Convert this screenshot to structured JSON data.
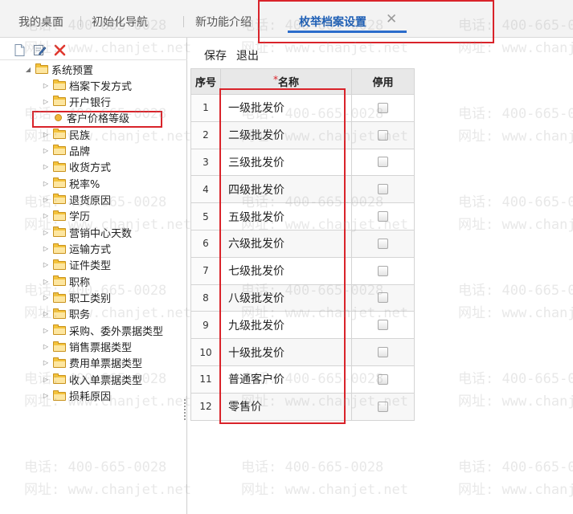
{
  "tabs": [
    {
      "label": "我的桌面"
    },
    {
      "label": "初始化导航"
    },
    {
      "label": "新功能介绍"
    },
    {
      "label": "枚举档案设置",
      "active": true
    }
  ],
  "tree": {
    "root": "系统预置",
    "items": [
      {
        "label": "档案下发方式"
      },
      {
        "label": "开户银行"
      },
      {
        "label": "客户价格等级",
        "selected": true
      },
      {
        "label": "民族"
      },
      {
        "label": "品牌"
      },
      {
        "label": "收货方式"
      },
      {
        "label": "税率%"
      },
      {
        "label": "退货原因"
      },
      {
        "label": "学历"
      },
      {
        "label": "营销中心天数"
      },
      {
        "label": "运输方式"
      },
      {
        "label": "证件类型"
      },
      {
        "label": "职称"
      },
      {
        "label": "职工类别"
      },
      {
        "label": "职务"
      },
      {
        "label": "采购、委外票据类型"
      },
      {
        "label": "销售票据类型"
      },
      {
        "label": "费用单票据类型"
      },
      {
        "label": "收入单票据类型"
      },
      {
        "label": "损耗原因"
      }
    ]
  },
  "toolbar": {
    "save_label": "保存",
    "exit_label": "退出"
  },
  "table": {
    "headers": {
      "no": "序号",
      "required_mark": "*",
      "name": "名称",
      "disabled": "停用"
    },
    "rows": [
      {
        "no": "1",
        "name": "一级批发价"
      },
      {
        "no": "2",
        "name": "二级批发价"
      },
      {
        "no": "3",
        "name": "三级批发价"
      },
      {
        "no": "4",
        "name": "四级批发价"
      },
      {
        "no": "5",
        "name": "五级批发价"
      },
      {
        "no": "6",
        "name": "六级批发价"
      },
      {
        "no": "7",
        "name": "七级批发价"
      },
      {
        "no": "8",
        "name": "八级批发价"
      },
      {
        "no": "9",
        "name": "九级批发价"
      },
      {
        "no": "10",
        "name": "十级批发价"
      },
      {
        "no": "11",
        "name": "普通客户价"
      },
      {
        "no": "12",
        "name": "零售价"
      }
    ]
  },
  "watermark": {
    "phone": "电话: 400-665-0028",
    "site": "网址: www.chanjet.net"
  },
  "colors": {
    "accent": "#2b6ccb",
    "highlight": "#d9232a",
    "folder": "#f4c33c"
  }
}
